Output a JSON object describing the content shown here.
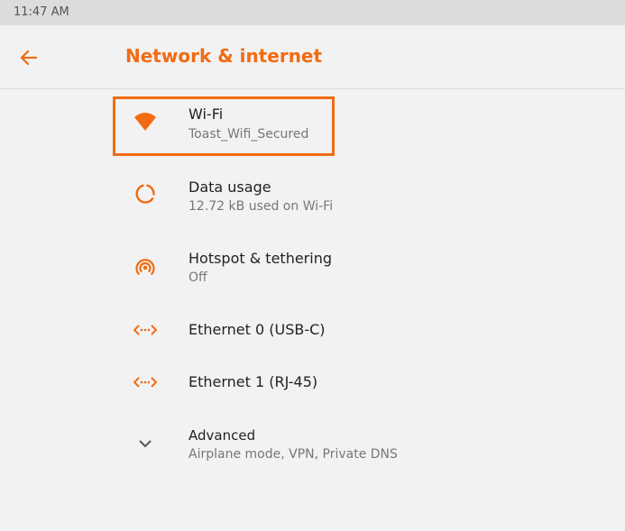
{
  "status_bar": {
    "time": "11:47 AM"
  },
  "app_bar": {
    "title": "Network & internet",
    "back_icon": "arrow-left-icon"
  },
  "accent_color": "#f26b12",
  "items": [
    {
      "title": "Wi-Fi",
      "summary": "Toast_Wifi_Secured",
      "icon": "wifi-icon"
    },
    {
      "title": "Data usage",
      "summary": "12.72 kB used on Wi-Fi",
      "icon": "data-usage-icon"
    },
    {
      "title": "Hotspot & tethering",
      "summary": "Off",
      "icon": "hotspot-icon"
    },
    {
      "title": "Ethernet 0 (USB-C)",
      "icon": "ethernet-icon"
    },
    {
      "title": "Ethernet 1 (RJ-45)",
      "icon": "ethernet-icon"
    },
    {
      "title": "Advanced",
      "summary": "Airplane mode, VPN, Private DNS",
      "icon": "chevron-down-icon"
    }
  ]
}
